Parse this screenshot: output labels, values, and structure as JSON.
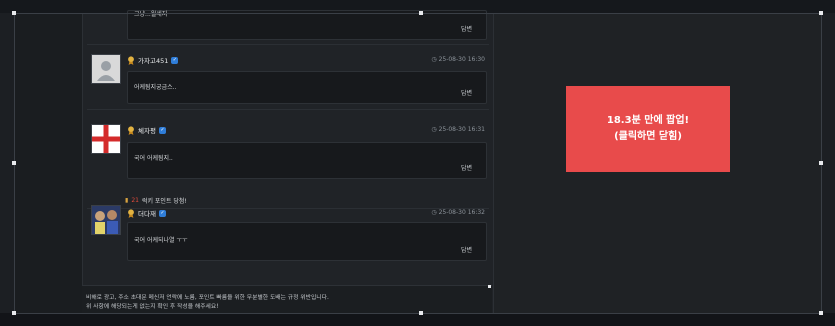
{
  "comments": [
    {
      "username": "",
      "timestamp": "",
      "text": "그냥...월세지",
      "reply_label": "답변"
    },
    {
      "username": "가자고451",
      "timestamp": "25-08-30 16:30",
      "text": "어케됨지궁금스..",
      "reply_label": "답변",
      "avatar": "default-avatar-icon"
    },
    {
      "username": "체자평",
      "timestamp": "25-08-30 16:31",
      "text": "국어 어케됨지..",
      "reply_label": "답변",
      "avatar": "red-cross-flag",
      "point_text": "럭키 포인트 당첨!",
      "point_value": "21"
    },
    {
      "username": "더다재",
      "timestamp": "25-08-30 16:32",
      "text": "국어 어케되나열 ㅜㅜ",
      "reply_label": "답변",
      "avatar": "photo-avatar"
    }
  ],
  "notice": {
    "line1": "비해로 광고, 주소 초대문 메신저 언락에 노름, 포인트 빠름을 위한 무분별한 도배는 규정 위반입니다.",
    "line2": "위 사항에 해당되는게 없는지 확인 후 작성을 해주세요!"
  },
  "popup": {
    "line1": "18.3분 만에 팝업!",
    "line2": "(클릭하면 닫힘)"
  },
  "colors": {
    "popup_bg": "#e84b4b",
    "verify": "#2f7dd8",
    "point_value": "#e14b3b"
  }
}
